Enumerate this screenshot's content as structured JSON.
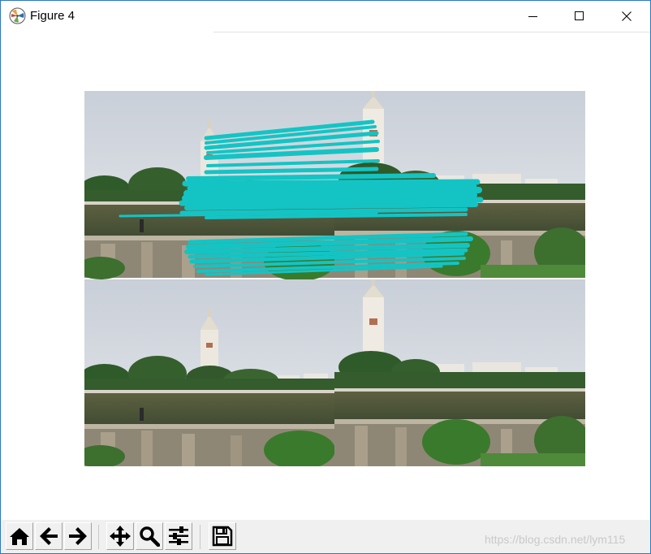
{
  "window": {
    "title": "Figure 4"
  },
  "titlebar_buttons": {
    "minimize_icon": "minimize-icon",
    "maximize_icon": "maximize-icon",
    "close_icon": "close-icon"
  },
  "toolbar": {
    "tools": [
      {
        "name": "home-button",
        "icon": "home-icon"
      },
      {
        "name": "back-button",
        "icon": "arrow-left-icon"
      },
      {
        "name": "forward-button",
        "icon": "arrow-right-icon"
      },
      {
        "name": "pan-button",
        "icon": "move-icon"
      },
      {
        "name": "zoom-button",
        "icon": "magnifier-icon"
      },
      {
        "name": "subplots-button",
        "icon": "sliders-icon"
      },
      {
        "name": "save-button",
        "icon": "floppy-disk-icon"
      }
    ],
    "watermark": "https://blog.csdn.net/lym115"
  },
  "colors": {
    "match_lines": "#14c4c4",
    "window_border": "#2b79c2",
    "toolbar_bg": "#f0f0f0"
  }
}
